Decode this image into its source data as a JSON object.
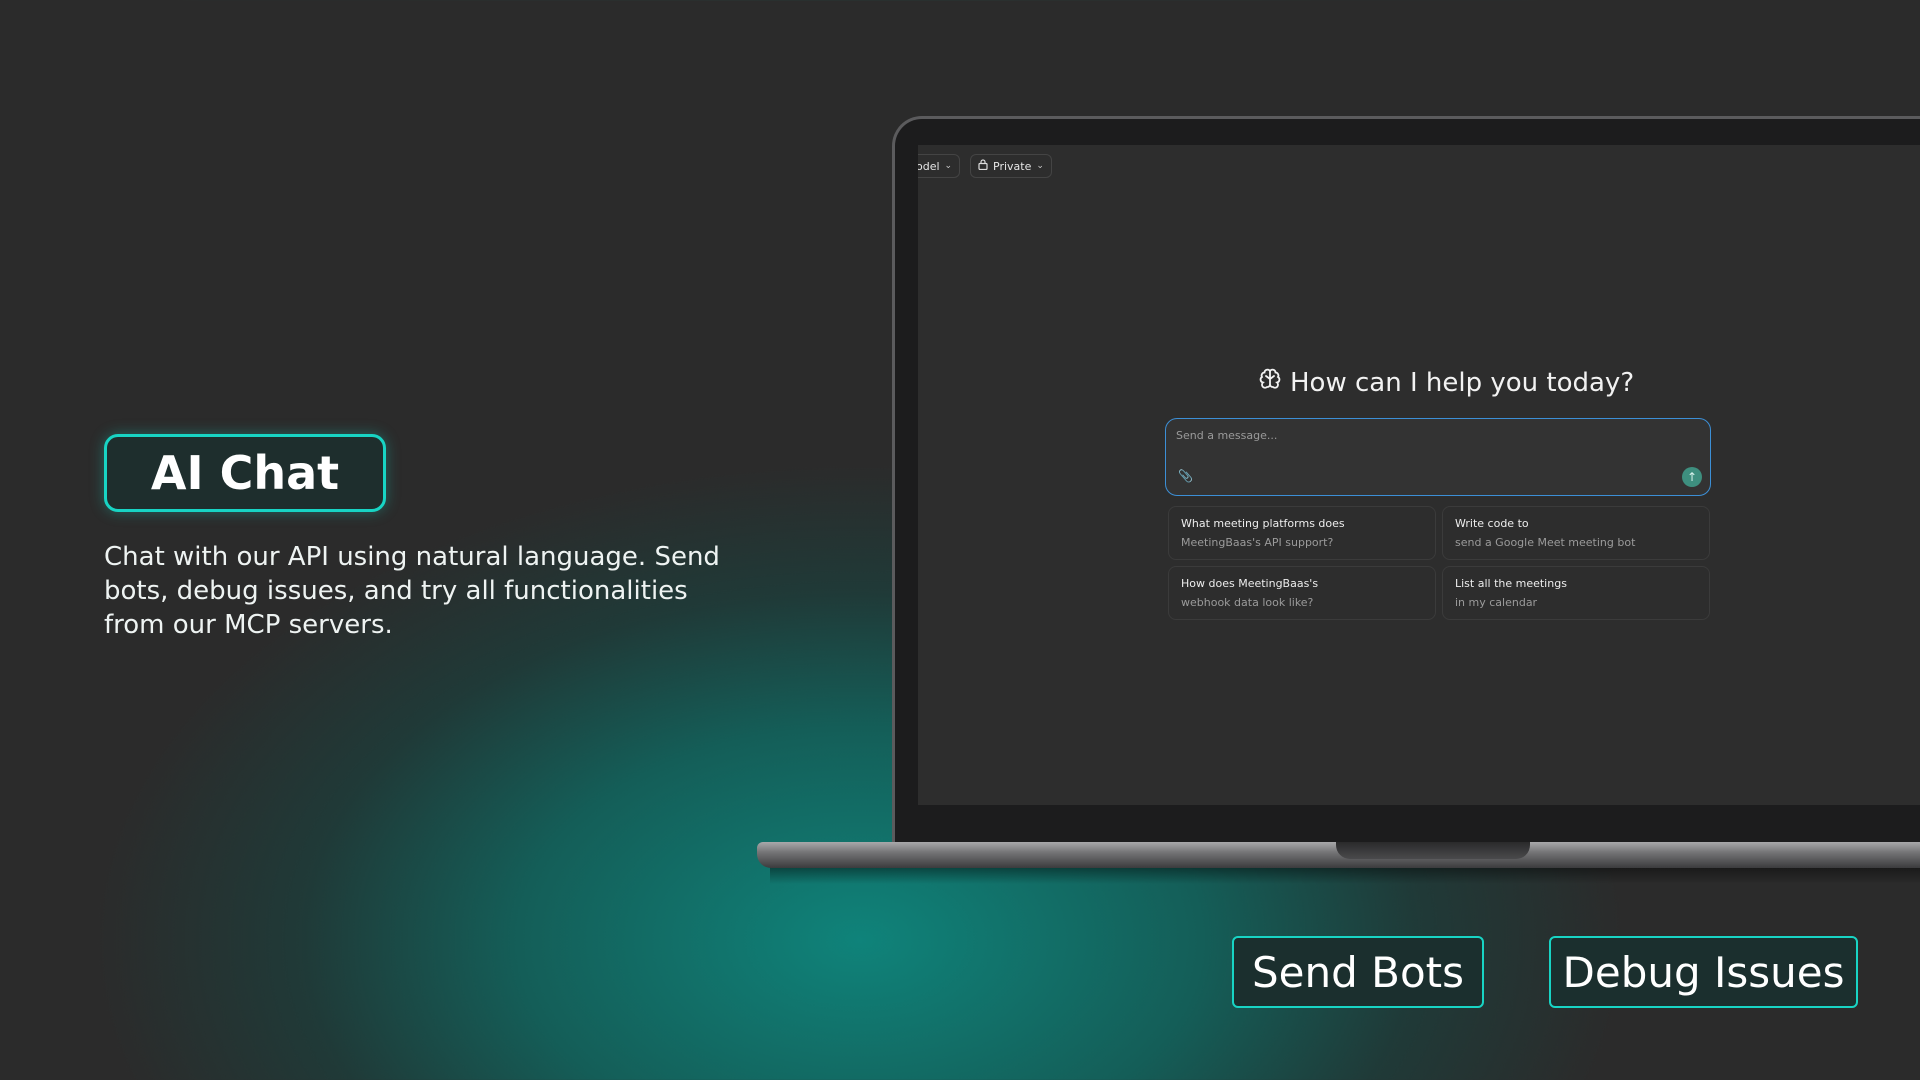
{
  "promo": {
    "title": "AI Chat",
    "description": "Chat with our API using natural language. Send bots, debug issues, and try all functionalities from our MCP servers."
  },
  "features": {
    "send_bots": "Send Bots",
    "debug_issues": "Debug Issues"
  },
  "app": {
    "model_selector": "odel",
    "visibility_selector": "Private",
    "greeting": "How can I help you today?",
    "composer": {
      "placeholder": "Send a message..."
    },
    "suggestions": [
      {
        "title": "What meeting platforms does",
        "subtitle": "MeetingBaas's API support?"
      },
      {
        "title": "Write code to",
        "subtitle": "send a Google Meet meeting bot"
      },
      {
        "title": "How does MeetingBaas's",
        "subtitle": "webhook data look like?"
      },
      {
        "title": "List all the meetings",
        "subtitle": "in my calendar"
      }
    ]
  },
  "colors": {
    "accent": "#18d4c4",
    "focus_border": "#3c8fd6",
    "send_button": "#3e8f7f"
  },
  "icons": [
    "brain-icon",
    "lock-icon",
    "chevron-down-icon",
    "paperclip-icon",
    "arrow-up-icon"
  ]
}
